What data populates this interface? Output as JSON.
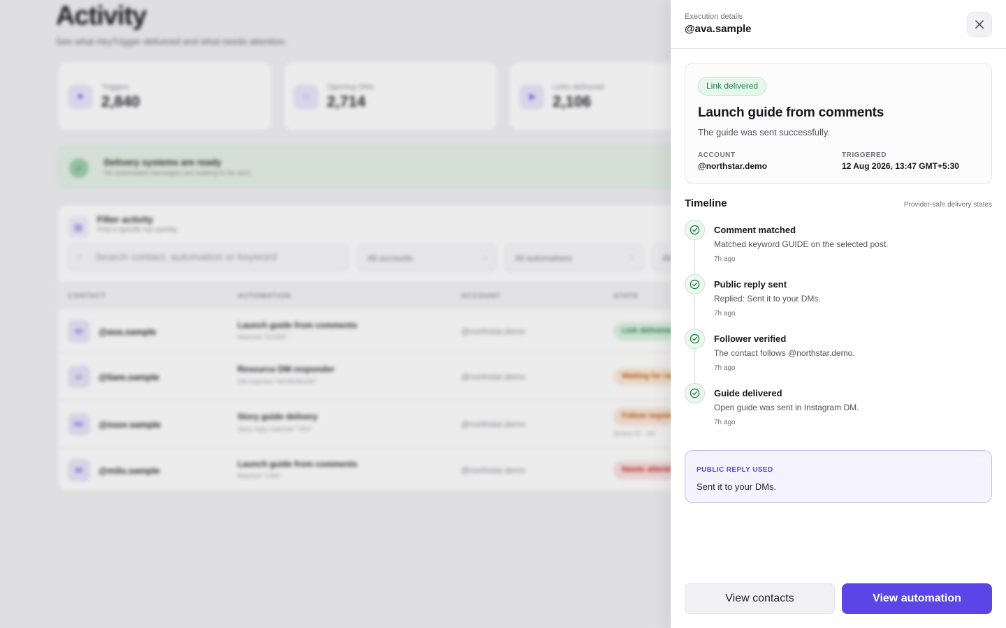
{
  "background": {
    "title": "Activity",
    "subtitle": "See what HeyTrigger delivered and what needs attention.",
    "stats": [
      {
        "label": "Triggers",
        "value": "2,840"
      },
      {
        "label": "Opening DMs",
        "value": "2,714"
      },
      {
        "label": "Links delivered",
        "value": "2,106"
      }
    ],
    "ready": {
      "title": "Delivery systems are ready",
      "subtitle": "No automated messages are waiting to be sent."
    },
    "filter": {
      "title": "Filter activity",
      "subtitle": "Find a specific run quickly.",
      "search_placeholder": "Search contact, automation or keyword",
      "accounts": "All accounts",
      "automations": "All automations",
      "states": "All"
    },
    "columns": [
      "CONTACT",
      "AUTOMATION",
      "ACCOUNT",
      "STATE"
    ],
    "rows": [
      {
        "initials": "AV",
        "contact": "@ava.sample",
        "automation": "Launch guide from comments",
        "match": "Matched \"GUIDE\"",
        "account": "@northstar.demo",
        "state": "Link delivered",
        "state_color": "#1f7a3f",
        "state_bg": "#d8eddf"
      },
      {
        "initials": "LI",
        "contact": "@liam.sample",
        "automation": "Resource DM responder",
        "match": "DM matched \"WORKBOOK\"",
        "account": "@northstar.demo",
        "state": "Waiting for reply",
        "state_color": "#b45309",
        "state_bg": "#f6e7d6"
      },
      {
        "initials": "NO",
        "contact": "@noor.sample",
        "automation": "Story guide delivery",
        "match": "Story reply matched \"YES\"",
        "account": "@northstar.demo",
        "state": "Follow required",
        "state_color": "#b45309",
        "state_bg": "#f6e2d6",
        "note": "Queue #2 · est."
      },
      {
        "initials": "MI",
        "contact": "@milo.sample",
        "automation": "Launch guide from comments",
        "match": "Matched \"LINK\"",
        "account": "@northstar.demo",
        "state": "Needs attention",
        "state_color": "#b91c1c",
        "state_bg": "#f5dcdc"
      }
    ]
  },
  "drawer": {
    "eyebrow": "Execution details",
    "title": "@ava.sample",
    "badge": "Link delivered",
    "summary_title": "Launch guide from comments",
    "summary_desc": "The guide was sent successfully.",
    "account_label": "ACCOUNT",
    "account_value": "@northstar.demo",
    "triggered_label": "TRIGGERED",
    "triggered_value": "12 Aug 2026, 13:47 GMT+5:30",
    "timeline_heading": "Timeline",
    "timeline_note": "Provider-safe delivery states",
    "timeline": [
      {
        "title": "Comment matched",
        "desc": "Matched keyword GUIDE on the selected post.",
        "time": "7h ago"
      },
      {
        "title": "Public reply sent",
        "desc": "Replied: Sent it to your DMs.",
        "time": "7h ago"
      },
      {
        "title": "Follower verified",
        "desc": "The contact follows @northstar.demo.",
        "time": "7h ago"
      },
      {
        "title": "Guide delivered",
        "desc": "Open guide was sent in Instagram DM.",
        "time": "7h ago"
      }
    ],
    "reply_label": "PUBLIC REPLY USED",
    "reply_text": "Sent it to your DMs.",
    "secondary_button": "View contacts",
    "primary_button": "View automation"
  },
  "colors": {
    "accent": "#5b45e6",
    "success": "#1f7a3f",
    "success_bg": "#e6f7ec",
    "reply_bg": "#f5f3ff"
  },
  "icons": {
    "close": "close-icon",
    "check": "check-circle-icon",
    "search": "search-icon",
    "chevron": "chevron-down-icon"
  }
}
